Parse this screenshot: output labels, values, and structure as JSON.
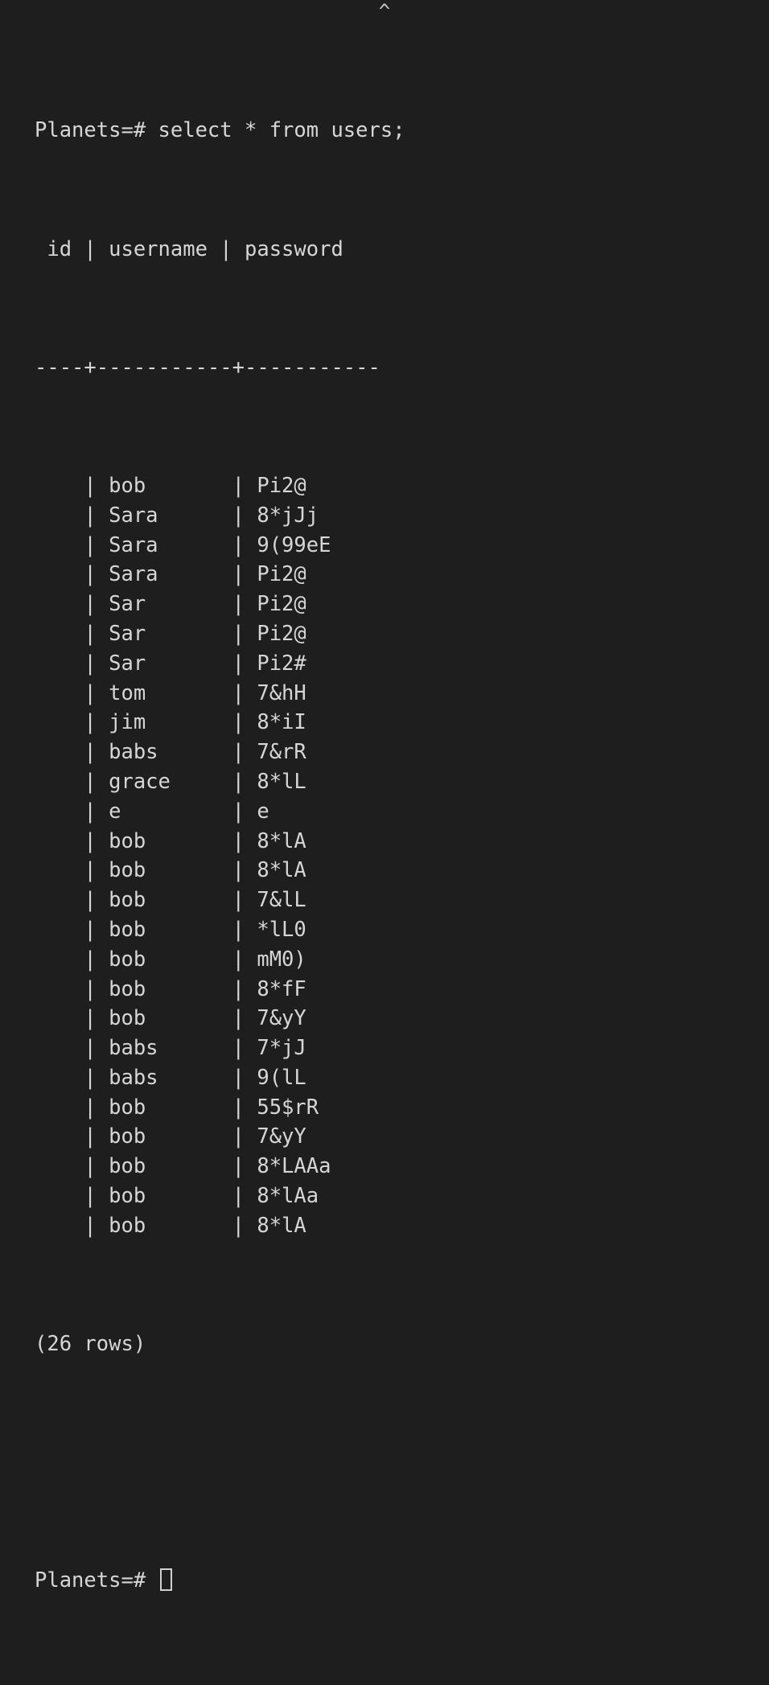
{
  "terminal": {
    "background_color": "#1e1e1e",
    "text_color": "#d6d6d6",
    "scroll_up_caret": "^",
    "prompt": "Planets=#",
    "command": "select * from users;",
    "command_line": "Planets=# select * from users;",
    "header_line": " id | username | password",
    "separator_line": "----+-----------+-----------",
    "row_count_line": "(26 rows)",
    "blank_line": "",
    "final_prompt": "Planets=# "
  },
  "columns": [
    "id",
    "username",
    "password"
  ],
  "rows": [
    {
      "id": "",
      "username": "bob",
      "password": "Pi2@",
      "line": "    | bob       | Pi2@"
    },
    {
      "id": "",
      "username": "Sara",
      "password": "8*jJj",
      "line": "    | Sara      | 8*jJj"
    },
    {
      "id": "",
      "username": "Sara",
      "password": "9(99eE",
      "line": "    | Sara      | 9(99eE"
    },
    {
      "id": "",
      "username": "Sara",
      "password": "Pi2@",
      "line": "    | Sara      | Pi2@"
    },
    {
      "id": "",
      "username": "Sar",
      "password": "Pi2@",
      "line": "    | Sar       | Pi2@"
    },
    {
      "id": "",
      "username": "Sar",
      "password": "Pi2@",
      "line": "    | Sar       | Pi2@"
    },
    {
      "id": "",
      "username": "Sar",
      "password": "Pi2#",
      "line": "    | Sar       | Pi2#"
    },
    {
      "id": "",
      "username": "tom",
      "password": "7&hH",
      "line": "    | tom       | 7&hH"
    },
    {
      "id": "",
      "username": "jim",
      "password": "8*iI",
      "line": "    | jim       | 8*iI"
    },
    {
      "id": "",
      "username": "babs",
      "password": "7&rR",
      "line": "    | babs      | 7&rR"
    },
    {
      "id": "",
      "username": "grace",
      "password": "8*lL",
      "line": "    | grace     | 8*lL"
    },
    {
      "id": "",
      "username": "e",
      "password": "e",
      "line": "    | e         | e"
    },
    {
      "id": "",
      "username": "bob",
      "password": "8*lA",
      "line": "    | bob       | 8*lA"
    },
    {
      "id": "",
      "username": "bob",
      "password": "8*lA",
      "line": "    | bob       | 8*lA"
    },
    {
      "id": "",
      "username": "bob",
      "password": "7&lL",
      "line": "    | bob       | 7&lL"
    },
    {
      "id": "",
      "username": "bob",
      "password": "*lL0",
      "line": "    | bob       | *lL0"
    },
    {
      "id": "",
      "username": "bob",
      "password": "mM0)",
      "line": "    | bob       | mM0)"
    },
    {
      "id": "",
      "username": "bob",
      "password": "8*fF",
      "line": "    | bob       | 8*fF"
    },
    {
      "id": "",
      "username": "bob",
      "password": "7&yY",
      "line": "    | bob       | 7&yY"
    },
    {
      "id": "",
      "username": "babs",
      "password": "7*jJ",
      "line": "    | babs      | 7*jJ"
    },
    {
      "id": "",
      "username": "babs",
      "password": "9(lL",
      "line": "    | babs      | 9(lL"
    },
    {
      "id": "",
      "username": "bob",
      "password": "55$rR",
      "line": "    | bob       | 55$rR"
    },
    {
      "id": "",
      "username": "bob",
      "password": "7&yY",
      "line": "    | bob       | 7&yY"
    },
    {
      "id": "",
      "username": "bob",
      "password": "8*LAAa",
      "line": "    | bob       | 8*LAAa"
    },
    {
      "id": "",
      "username": "bob",
      "password": "8*lAa",
      "line": "    | bob       | 8*lAa"
    },
    {
      "id": "",
      "username": "bob",
      "password": "8*lA",
      "line": "    | bob       | 8*lA"
    }
  ],
  "scrollbar": {
    "thumb_color": "#4a4a4c"
  }
}
